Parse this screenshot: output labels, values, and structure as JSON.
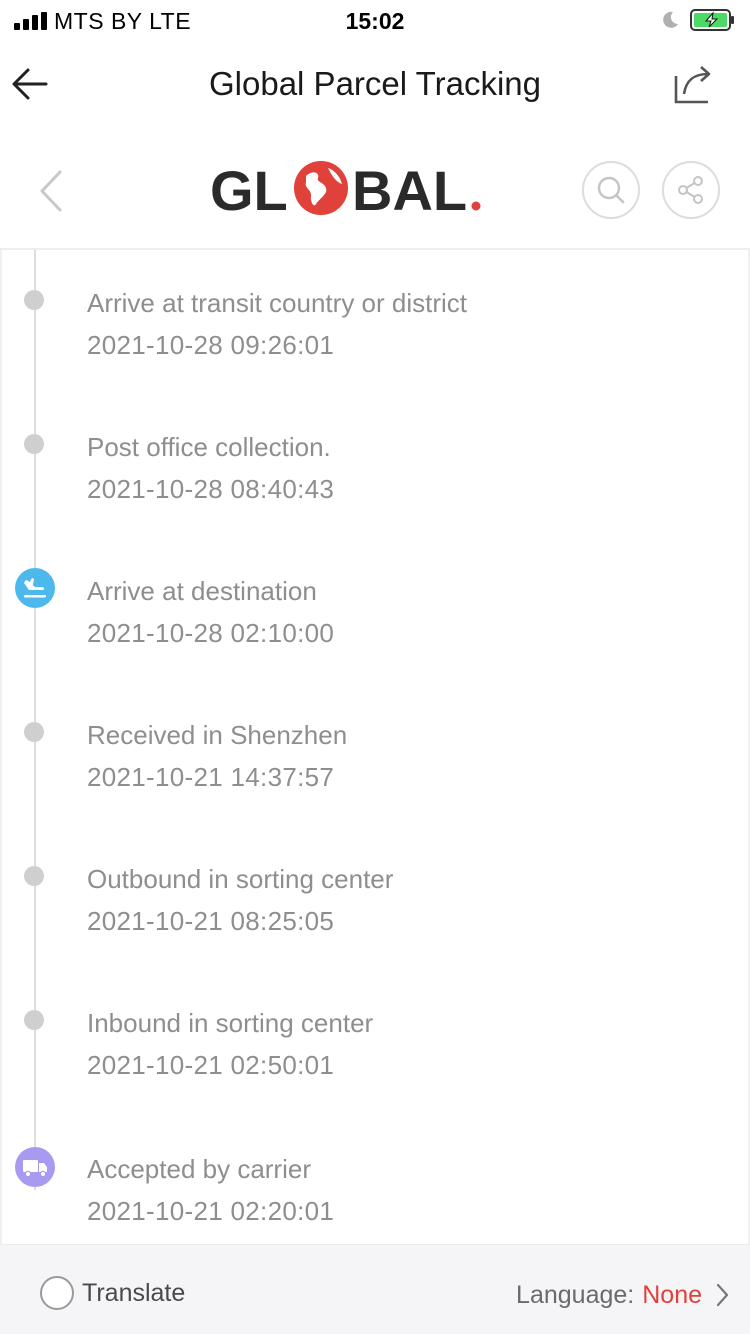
{
  "status_bar": {
    "carrier": "MTS BY   LTE",
    "time": "15:02"
  },
  "nav": {
    "title": "Global Parcel Tracking"
  },
  "brand": {
    "logo_text_left": "GL",
    "logo_text_right": "BAL",
    "accent_color": "#e0413a"
  },
  "events": [
    {
      "title": "Arrive at transit country or district",
      "time": "2021-10-28 09:26:01",
      "marker": "dot"
    },
    {
      "title": "Post office collection.",
      "time": "2021-10-28 08:40:43",
      "marker": "dot"
    },
    {
      "title": "Arrive at destination",
      "time": "2021-10-28 02:10:00",
      "marker": "plane-landing-icon",
      "marker_color": "#4cb8ec"
    },
    {
      "title": "Received in Shenzhen",
      "time": "2021-10-21 14:37:57",
      "marker": "dot"
    },
    {
      "title": "Outbound in sorting center",
      "time": "2021-10-21 08:25:05",
      "marker": "dot"
    },
    {
      "title": "Inbound in sorting center",
      "time": "2021-10-21 02:50:01",
      "marker": "dot"
    },
    {
      "title": "Accepted by carrier",
      "time": "2021-10-21 02:20:01",
      "marker": "truck-icon",
      "marker_color": "#a89af0"
    }
  ],
  "bottom": {
    "translate_label": "Translate",
    "language_label": "Language:",
    "language_value": "None"
  }
}
